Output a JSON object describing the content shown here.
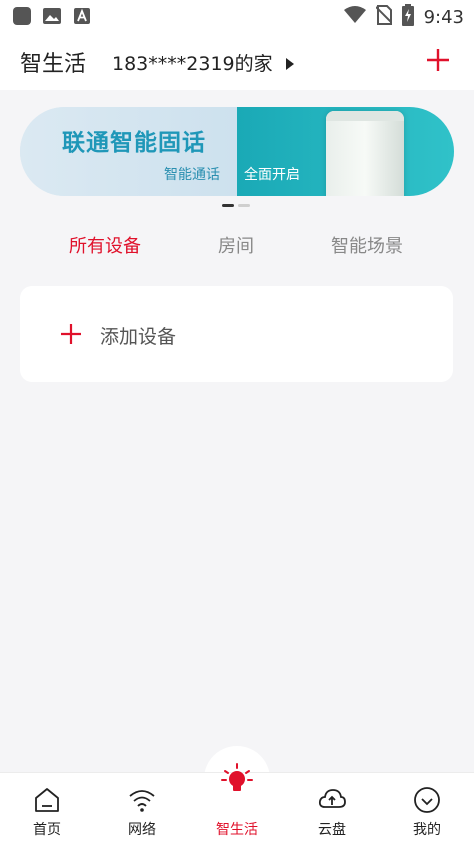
{
  "status_bar": {
    "time": "9:43",
    "icons": [
      "app-square-icon",
      "image-icon",
      "font-a-icon",
      "wifi-icon",
      "no-sim-icon",
      "battery-charging-icon"
    ]
  },
  "header": {
    "title": "智生活",
    "home_name": "183****2319的家",
    "caret_icon": "caret-right-icon",
    "add_icon": "plus-icon"
  },
  "banner": {
    "title": "联通智能固话",
    "subtitle_left": "智能通话",
    "subtitle_right": "全面开启",
    "page_count": 2,
    "current_page": 1
  },
  "tabs": [
    {
      "label": "所有设备",
      "active": true
    },
    {
      "label": "房间",
      "active": false
    },
    {
      "label": "智能场景",
      "active": false
    }
  ],
  "add_device": {
    "label": "添加设备",
    "icon": "plus-icon"
  },
  "bottom_nav": [
    {
      "label": "首页",
      "icon": "home-icon",
      "active": false
    },
    {
      "label": "网络",
      "icon": "wifi-icon",
      "active": false
    },
    {
      "label": "智生活",
      "icon": "lightbulb-icon",
      "active": true
    },
    {
      "label": "云盘",
      "icon": "cloud-upload-icon",
      "active": false
    },
    {
      "label": "我的",
      "icon": "smile-icon",
      "active": false
    }
  ],
  "colors": {
    "accent": "#e0112b",
    "banner_text": "#1f97b8",
    "banner_right": "#1aa9b6",
    "background": "#f5f5f7"
  }
}
